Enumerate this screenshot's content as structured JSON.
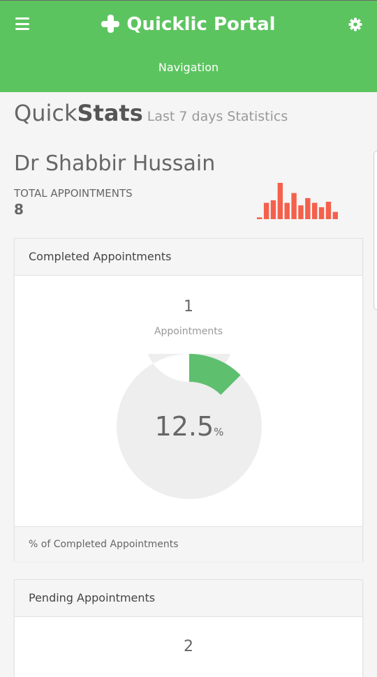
{
  "header": {
    "title": "Quicklic Portal",
    "nav_label": "Navigation",
    "brand_color": "#5cc45f"
  },
  "quickstats": {
    "title_light": "Quick",
    "title_bold": "Stats",
    "subtitle": "Last 7 days Statistics"
  },
  "doctor": {
    "name": "Dr Shabbir Hussain",
    "total_label": "TOTAL APPOINTMENTS",
    "total_value": "8",
    "sparkline_color": "#f4604c",
    "sparkline_values": [
      0.05,
      0.45,
      0.52,
      1.0,
      0.45,
      0.72,
      0.38,
      0.58,
      0.45,
      0.33,
      0.48,
      0.2
    ]
  },
  "completed_panel": {
    "title": "Completed Appointments",
    "count": "1",
    "count_label": "Appointments",
    "percent": "12.5",
    "percent_unit": "%",
    "percent_value": 12.5,
    "footer": "% of Completed Appointments",
    "fill_color": "#5ebf6f",
    "track_color": "#eeeeee"
  },
  "pending_panel": {
    "title": "Pending Appointments",
    "count": "2"
  }
}
